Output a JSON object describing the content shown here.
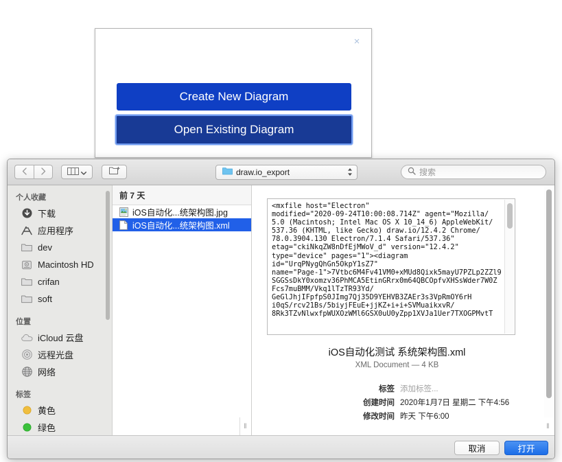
{
  "drawio_dialog": {
    "close_label": "×",
    "create_label": "Create New Diagram",
    "open_label": "Open Existing Diagram"
  },
  "finder": {
    "toolbar": {
      "back_icon": "chevron-left-icon",
      "forward_icon": "chevron-right-icon",
      "view_icon": "column-view-icon",
      "view_chevron": "chevron-down-icon",
      "new_folder_icon": "new-folder-icon",
      "path_label": "draw.io_export",
      "path_folder_icon": "folder-icon",
      "search_icon": "search-icon",
      "search_placeholder": "搜索",
      "search_value": ""
    },
    "sidebar": {
      "sections": [
        {
          "title": "个人收藏",
          "items": [
            {
              "label": "下载",
              "icon": "download-icon"
            },
            {
              "label": "应用程序",
              "icon": "applications-icon"
            },
            {
              "label": "dev",
              "icon": "folder-icon"
            },
            {
              "label": "Macintosh HD",
              "icon": "harddisk-icon"
            },
            {
              "label": "crifan",
              "icon": "folder-icon"
            },
            {
              "label": "soft",
              "icon": "folder-icon"
            }
          ]
        },
        {
          "title": "位置",
          "items": [
            {
              "label": "iCloud 云盘",
              "icon": "cloud-icon"
            },
            {
              "label": "远程光盘",
              "icon": "disc-icon"
            },
            {
              "label": "网络",
              "icon": "globe-icon"
            }
          ]
        },
        {
          "title": "标签",
          "items": [
            {
              "label": "黄色",
              "icon": "tag-dot-icon",
              "color": "#f0be3e"
            },
            {
              "label": "绿色",
              "icon": "tag-dot-icon",
              "color": "#3bc13b"
            }
          ]
        }
      ]
    },
    "filelist": {
      "group_header": "前 7 天",
      "rows": [
        {
          "name": "iOS自动化...统架构图.jpg",
          "icon": "image-file-icon",
          "selected": false
        },
        {
          "name": "iOS自动化...统架构图.xml",
          "icon": "document-file-icon",
          "selected": true
        }
      ],
      "resize_grip": "‖"
    },
    "preview": {
      "xml_content": "<mxfile host=\"Electron\"\nmodified=\"2020-09-24T10:00:08.714Z\" agent=\"Mozilla/\n5.0 (Macintosh; Intel Mac OS X 10_14_6) AppleWebKit/\n537.36 (KHTML, like Gecko) draw.io/12.4.2 Chrome/\n78.0.3904.130 Electron/7.1.4 Safari/537.36\"\netag=\"ckiNkqZW8nDfEjMWoV_d\" version=\"12.4.2\"\ntype=\"device\" pages=\"1\"><diagram\nid=\"UrqPNygQhGn5OkpY1sZ7\"\nname=\"Page-1\">7Vtbc6M4Fv41VM0+xMUd8Qixk5mayU7PZLp2ZZl9\nSGGSsDkY0xomzv36PhMCA5EtinGRrx0m64QBCOpfvXHSsWder7W0Z\nFcs7muBMM/Vkq1lTzTR93Yd/\nGeGlJhjIFpfpS0JImg7Qj35D9YEHVB3ZAEr3s3VpRmOY6rH\ni0qS/rcv21Bs/5biyjFEuE+jjKZ+i+i+SVMuaikxvR/\n8Rk3TZvNlwxfpWUXOzWMl6GSX0uU0yZpp1XVJa1Uer7TXOGPMvtT",
      "title": "iOS自动化测试 系统架构图.xml",
      "subtitle": "XML Document — 4 KB",
      "meta": [
        {
          "key": "标签",
          "value": "添加标签...",
          "muted": true
        },
        {
          "key": "创建时间",
          "value": "2020年1月7日 星期二 下午4:56",
          "muted": false
        },
        {
          "key": "修改时间",
          "value": "昨天 下午6:00",
          "muted": false
        }
      ],
      "resize_grip": "‖"
    },
    "footer": {
      "cancel_label": "取消",
      "open_label": "打开"
    }
  },
  "colors": {
    "selection_blue": "#2160e8",
    "primary_button_blue": "#1c6ee8",
    "drawio_blue": "#0f3fc4",
    "drawio_blue_dark": "#183a95"
  }
}
